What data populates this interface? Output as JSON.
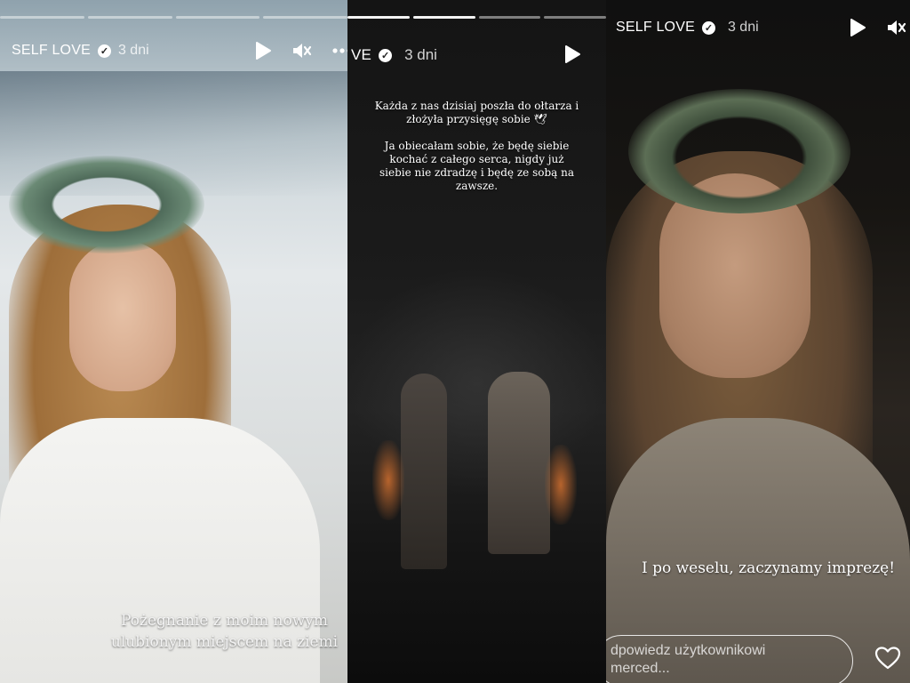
{
  "panels": [
    {
      "username": "SELF LOVE",
      "age": "3 dni",
      "progress_done": 0,
      "caption": "Pożegnanie z moim nowym ulubionym miejscem na ziemi"
    },
    {
      "username": "VE",
      "age": "3 dni",
      "progress_done": 2,
      "caption": "Każda z nas dzisiaj poszła do ołtarza i złożyła przysięgę sobie 🕊\n\nJa obiecałam sobie, że będę siebie kochać z całego serca, nigdy już siebie nie zdradzę i będę ze sobą na zawsze."
    },
    {
      "username": "SELF LOVE",
      "age": "3 dni",
      "caption": "I po weselu, zaczynamy imprezę!",
      "reply_placeholder": "dpowiedz użytkownikowi\nmerced..."
    }
  ],
  "icons": {
    "play": "play-icon",
    "mute": "mute-icon",
    "more": "more-icon",
    "like": "heart-icon",
    "verified": "verified-badge-icon"
  }
}
